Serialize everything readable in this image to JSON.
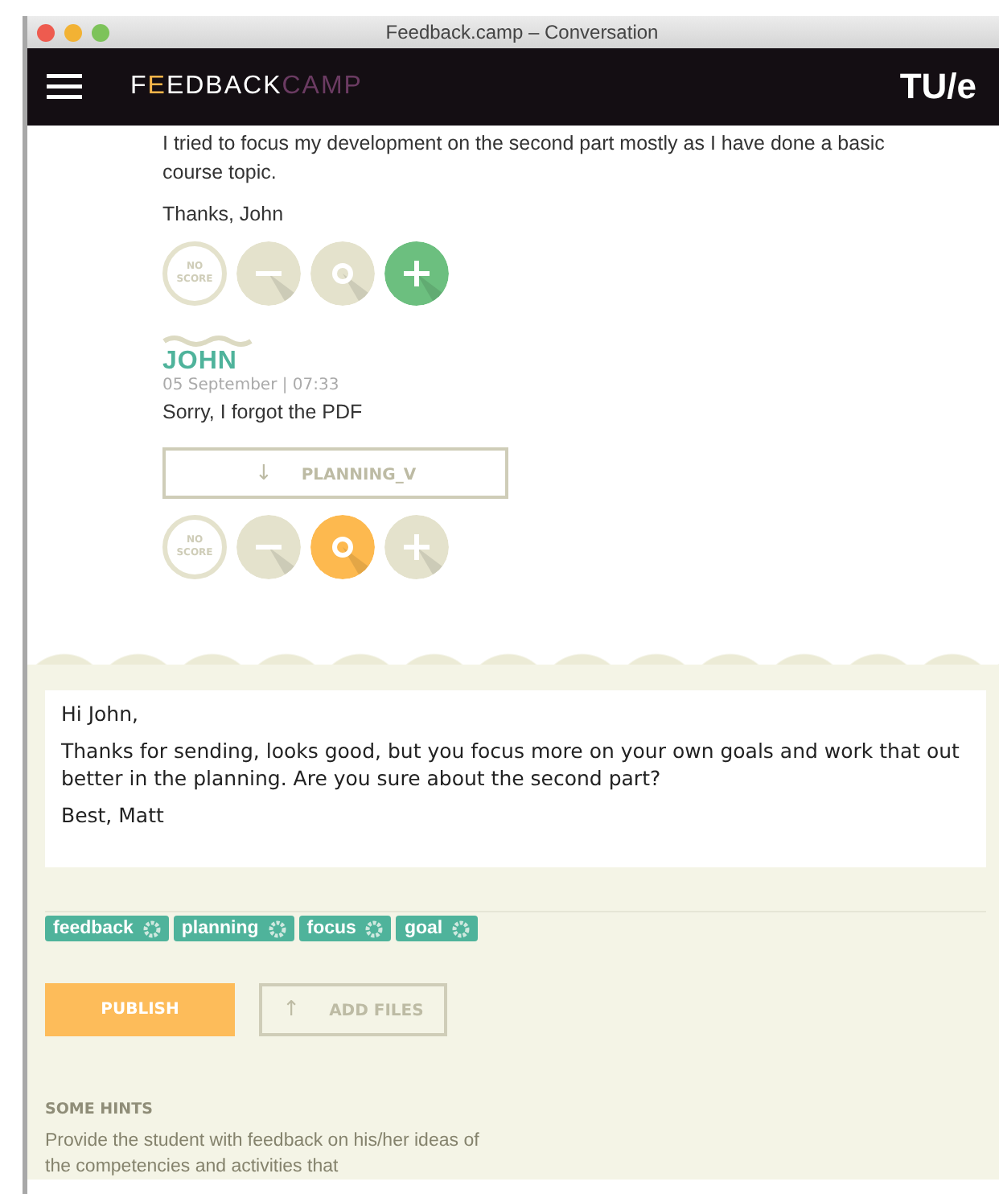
{
  "window": {
    "title": "Feedback.camp – Conversation"
  },
  "header": {
    "logo_main": "F",
    "logo_accent": "E",
    "logo_rest": "EDBACK",
    "logo_camp": "CAMP",
    "brand": "TU/e"
  },
  "messages": [
    {
      "lines": [
        "I tried to focus my development on the second part mostly as I have done a basic course topic.",
        "Thanks, John"
      ],
      "scores": [
        {
          "kind": "none",
          "label": "NO SCORE",
          "selected": false
        },
        {
          "kind": "minus",
          "selected": false
        },
        {
          "kind": "neutral",
          "selected": false
        },
        {
          "kind": "plus",
          "selected": true
        }
      ]
    },
    {
      "author": "JOHN",
      "date": "05 September | 07:33",
      "lines": [
        "Sorry, I forgot the PDF"
      ],
      "attachment": "PLANNING_V",
      "attachment_icon": "↓",
      "scores": [
        {
          "kind": "none",
          "label": "NO SCORE",
          "selected": false
        },
        {
          "kind": "minus",
          "selected": false
        },
        {
          "kind": "neutral",
          "selected": true
        },
        {
          "kind": "plus",
          "selected": false
        }
      ]
    }
  ],
  "reply": {
    "paragraphs": [
      "Hi John,",
      "Thanks for sending, looks good, but you focus more on your own goals and work that out better in the planning. Are you sure about the second part?",
      "Best, Matt"
    ]
  },
  "tags": [
    "feedback",
    "planning",
    "focus",
    "goal"
  ],
  "buttons": {
    "publish": "PUBLISH",
    "add_files": "ADD FILES",
    "add_files_icon": "↑"
  },
  "hints": {
    "title": "SOME HINTS",
    "text": "Provide the student with feedback on his/her ideas of the competencies and activities that"
  }
}
